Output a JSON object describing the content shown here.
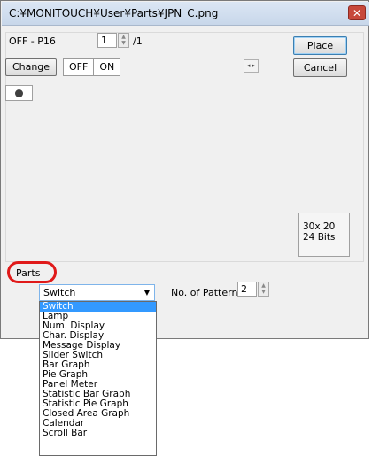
{
  "window": {
    "title": "C:¥MONITOUCH¥User¥Parts¥JPN_C.png",
    "close_glyph": "✕"
  },
  "pattern": {
    "label": "OFF - P16",
    "value": "1",
    "total": "/1"
  },
  "buttons": {
    "place": "Place",
    "cancel": "Cancel",
    "change": "Change"
  },
  "toggle": {
    "off": "OFF",
    "on": "ON"
  },
  "info": {
    "size": "30x 20",
    "bits": "24 Bits"
  },
  "parts": {
    "label": "Parts",
    "selected": "Switch",
    "patterns_label": "No. of Patterns",
    "patterns_value": "2",
    "options": [
      "Switch",
      "Lamp",
      "Num. Display",
      "Char. Display",
      "Message Display",
      "Slider Switch",
      "Bar Graph",
      "Pie Graph",
      "Panel Meter",
      "Statistic Bar Graph",
      "Statistic Pie Graph",
      "Closed Area Graph",
      "Calendar",
      "Scroll Bar"
    ]
  },
  "colors": {
    "highlight_circle": "#e01a1a",
    "selection": "#3399ff"
  }
}
